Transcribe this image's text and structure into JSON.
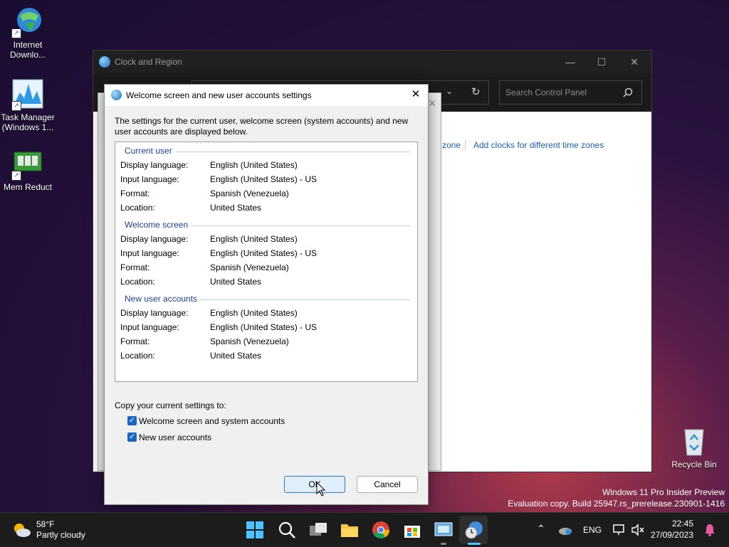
{
  "desktop": {
    "icons": [
      {
        "label_line1": "Internet",
        "label_line2": "Downlo..."
      },
      {
        "label_line1": "Task Manager",
        "label_line2": "(Windows 1..."
      },
      {
        "label_line1": "Mem Reduct",
        "label_line2": ""
      },
      {
        "label_line1": "Recycle Bin",
        "label_line2": ""
      }
    ],
    "watermark_line1": "Windows 11 Pro Insider Preview",
    "watermark_line2": "Evaluation copy. Build 25947.rs_prerelease.230901-1416"
  },
  "control_panel": {
    "title": "Clock and Region",
    "search_placeholder": "Search Control Panel",
    "link_partial": "zone",
    "link_add_clocks": "Add clocks for different time zones"
  },
  "dialog": {
    "title": "Welcome screen and new user accounts settings",
    "intro": "The settings for the current user, welcome screen (system accounts) and new user accounts are displayed below.",
    "sections": [
      {
        "heading": "Current user",
        "rows": [
          {
            "label": "Display language:",
            "value": "English (United States)"
          },
          {
            "label": "Input language:",
            "value": "English (United States) - US"
          },
          {
            "label": "Format:",
            "value": "Spanish (Venezuela)"
          },
          {
            "label": "Location:",
            "value": "United States"
          }
        ]
      },
      {
        "heading": "Welcome screen",
        "rows": [
          {
            "label": "Display language:",
            "value": "English (United States)"
          },
          {
            "label": "Input language:",
            "value": "English (United States) - US"
          },
          {
            "label": "Format:",
            "value": "Spanish (Venezuela)"
          },
          {
            "label": "Location:",
            "value": "United States"
          }
        ]
      },
      {
        "heading": "New user accounts",
        "rows": [
          {
            "label": "Display language:",
            "value": "English (United States)"
          },
          {
            "label": "Input language:",
            "value": "English (United States) - US"
          },
          {
            "label": "Format:",
            "value": "Spanish (Venezuela)"
          },
          {
            "label": "Location:",
            "value": "United States"
          }
        ]
      }
    ],
    "copy_label": "Copy your current settings to:",
    "checkboxes": [
      {
        "label": "Welcome screen and system accounts",
        "checked": true
      },
      {
        "label": "New user accounts",
        "checked": true
      }
    ],
    "ok_label": "OK",
    "cancel_label": "Cancel"
  },
  "taskbar": {
    "weather_temp": "58°F",
    "weather_desc": "Partly cloudy",
    "language": "ENG",
    "time": "22:45",
    "date": "27/09/2023"
  },
  "colors": {
    "accent": "#1a66c6",
    "section_heading": "#1c3f94",
    "link": "#1a5fb4"
  }
}
